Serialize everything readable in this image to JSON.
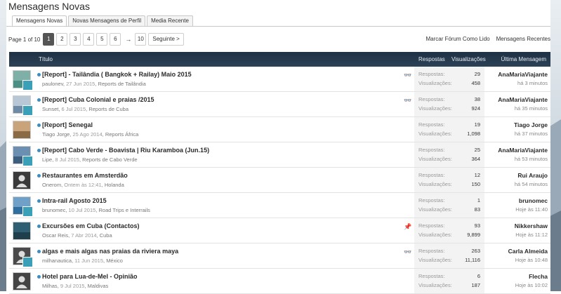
{
  "header": {
    "title": "Mensagens Novas"
  },
  "tabs": [
    "Mensagens Novas",
    "Novas Mensagens de Perfil",
    "Media Recente"
  ],
  "pagination": {
    "label": "Page 1 of 10",
    "pages": [
      "1",
      "2",
      "3",
      "4",
      "5",
      "6"
    ],
    "ellipsis": "→",
    "last": "10",
    "next": "Seguinte >"
  },
  "toplinks": [
    "Marcar Fórum Como Lido",
    "Mensagens Recentes"
  ],
  "columns": {
    "title": "Título",
    "replies": "Respostas",
    "views": "Visualizações",
    "last": "Última Mensagem"
  },
  "stat_labels": {
    "replies": "Respostas:",
    "views": "Visualizações:"
  },
  "threads": [
    {
      "title": "[Report] - Tailândia ( Bangkok + Railay) Maio 2015",
      "author": "paulonev",
      "date": "27 Jun 2015",
      "forum": "Reports de Tailândia",
      "replies": "29",
      "views": "458",
      "last_user": "AnaMariaViajante",
      "last_time": "há 3 minutos",
      "marker": "glasses-icon",
      "marker_glyph": "👓"
    },
    {
      "title": "[Report] Cuba Colonial e praias /2015",
      "author": "Sunset",
      "date": "6 Jul 2015",
      "forum": "Reports de Cuba",
      "replies": "38",
      "views": "924",
      "last_user": "AnaMariaViajante",
      "last_time": "há 35 minutos",
      "marker": "glasses-icon",
      "marker_glyph": "👓"
    },
    {
      "title": "[Report] Senegal",
      "author": "Tiago Jorge",
      "date": "25 Ago 2014",
      "forum": "Reports África",
      "replies": "19",
      "views": "1,098",
      "last_user": "Tiago Jorge",
      "last_time": "há 37 minutos",
      "marker": "",
      "marker_glyph": ""
    },
    {
      "title": "[Report] Cabo Verde - Boavista | Riu Karamboa (Jun.15)",
      "author": "Lipe",
      "date": "8 Jul 2015",
      "forum": "Reports de Cabo Verde",
      "replies": "25",
      "views": "364",
      "last_user": "AnaMariaViajante",
      "last_time": "há 53 minutos",
      "marker": "",
      "marker_glyph": ""
    },
    {
      "title": "Restaurantes em Amsterdão",
      "author": "Onerom",
      "date": "Ontem às 12:41",
      "forum": "Holanda",
      "replies": "12",
      "views": "150",
      "last_user": "Rui Araujo",
      "last_time": "há 54 minutos",
      "marker": "",
      "marker_glyph": ""
    },
    {
      "title": "Intra-rail Agosto 2015",
      "author": "brunomec",
      "date": "10 Jul 2015",
      "forum": "Road Trips e Interrails",
      "replies": "1",
      "views": "83",
      "last_user": "brunomec",
      "last_time": "Hoje às 11:40",
      "marker": "",
      "marker_glyph": ""
    },
    {
      "title": "Excursões em Cuba (Contactos)",
      "author": "Oscar Reis",
      "date": "7 Abr 2014",
      "forum": "Cuba",
      "replies": "93",
      "views": "9,899",
      "last_user": "Nikkershaw",
      "last_time": "Hoje às 11:12",
      "marker": "pin-icon",
      "marker_glyph": "📌"
    },
    {
      "title": "algas e mais algas nas praias da riviera maya",
      "author": "milhanautica",
      "date": "11 Jun 2015",
      "forum": "México",
      "replies": "263",
      "views": "11,116",
      "last_user": "Carla Almeida",
      "last_time": "Hoje às 10:48",
      "marker": "glasses-icon",
      "marker_glyph": "👓"
    },
    {
      "title": "Hotel para Lua-de-Mel - Opinião",
      "author": "Milhas",
      "date": "9 Jul 2015",
      "forum": "Maldivas",
      "replies": "6",
      "views": "187",
      "last_user": "Flecha",
      "last_time": "Hoje às 10:02",
      "marker": "",
      "marker_glyph": ""
    }
  ]
}
